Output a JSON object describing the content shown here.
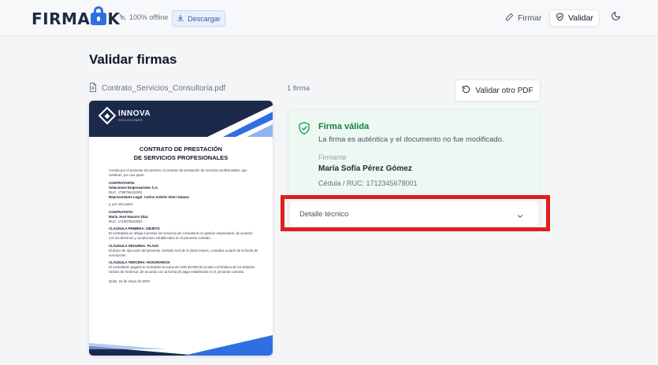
{
  "header": {
    "logo": {
      "pre": "FIRMA",
      "post": "K"
    },
    "offline_label": "100% offline",
    "download_label": "Descargar",
    "nav_firmar": "Firmar",
    "nav_validar": "Validar"
  },
  "page": {
    "title": "Validar firmas",
    "file_name": "Contrato_Servicios_Consultoria.pdf",
    "signature_count": "1 firma",
    "validate_other_label": "Validar otro PDF"
  },
  "document": {
    "brand_name": "INNOVA",
    "brand_sub": "SOLUCIONES",
    "title_line1": "CONTRATO DE PRESTACIÓN",
    "title_line2": "DE SERVICIOS PROFESIONALES",
    "intro": "Consta por el presente documento, el contrato de prestación de servicios profesionales, que celebran, por una parte:",
    "contratante_h": "CONTRATANTE:",
    "contratante_name": "Soluciones Empresariales S.A.",
    "contratante_ruc": "RUC: 1798765432001",
    "contratante_rep": "Representante Legal: Carlos Andrés Viteri Salazar",
    "other_party": "y, por otra parte:",
    "contratista_h": "CONTRATISTA:",
    "contratista_name": "María José Navarro Díaz",
    "contratista_ruc": "RUC: 1719876543001",
    "c1_h": "CLÁUSULA PRIMERA: OBJETO",
    "c1_t": "El contratista se obliga a prestar los servicios de consultoría en gestión empresarial, de acuerdo con los términos y condiciones establecidos en el presente contrato.",
    "c2_h": "CLÁUSULA SEGUNDA: PLAZO",
    "c2_t": "El plazo de ejecución del presente contrato será de 6 (seis) meses, contados a partir de la fecha de suscripción.",
    "c3_h": "CLÁUSULA TERCERA: HONORARIOS",
    "c3_t": "El contratante pagará al contratista la suma de USD $4.000,00 (cuatro mil dólares de los Estados Unidos de América), de acuerdo con la forma de pago establecida en el presente contrato.",
    "place_date": "Quito, 15 de mayo de 2025"
  },
  "result": {
    "title": "Firma válida",
    "description": "La firma es auténtica y el documento no fue modificado.",
    "signer_label": "Firmante",
    "signer_name": "María Sofía Pérez Gómez",
    "signer_id": "Cédula / RUC: 1712345678001",
    "tech_label": "Detalle técnico"
  },
  "colors": {
    "accent": "#2f6fe0",
    "valid_green": "#15803d",
    "valid_bg": "#ecf8f1",
    "doc_navy": "#1b2a4a",
    "highlight_red": "#e01e1e"
  },
  "icons": [
    "wifi-off-icon",
    "download-icon",
    "pen-icon",
    "shield-check-icon",
    "moon-icon",
    "file-icon",
    "refresh-icon",
    "chevron-down-icon"
  ]
}
